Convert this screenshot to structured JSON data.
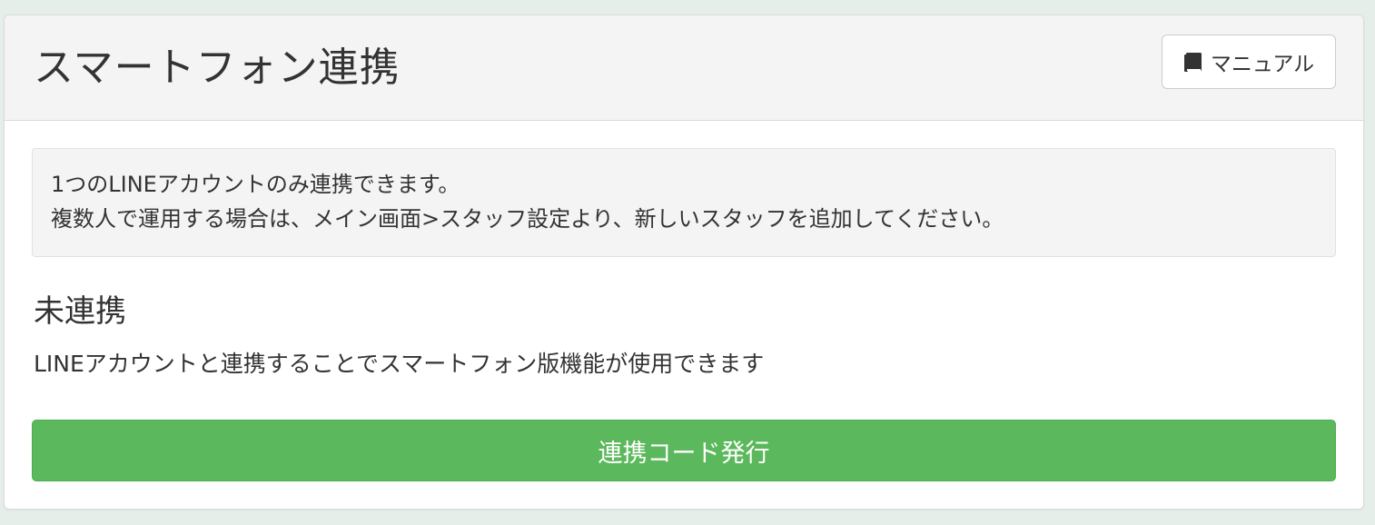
{
  "header": {
    "title": "スマートフォン連携",
    "manual_button_label": "マニュアル",
    "manual_icon": "book-icon"
  },
  "notice": {
    "lines": [
      "1つのLINEアカウントのみ連携できます。",
      "複数人で運用する場合は、メイン画面>スタッフ設定より、新しいスタッフを追加してください。"
    ]
  },
  "status": {
    "heading": "未連携",
    "description": "LINEアカウントと連携することでスマートフォン版機能が使用できます"
  },
  "actions": {
    "issue_code_label": "連携コード発行"
  },
  "colors": {
    "background": "#e6eee9",
    "header_background": "#f4f4f4",
    "primary_button": "#5cb85c",
    "text": "#333333"
  }
}
